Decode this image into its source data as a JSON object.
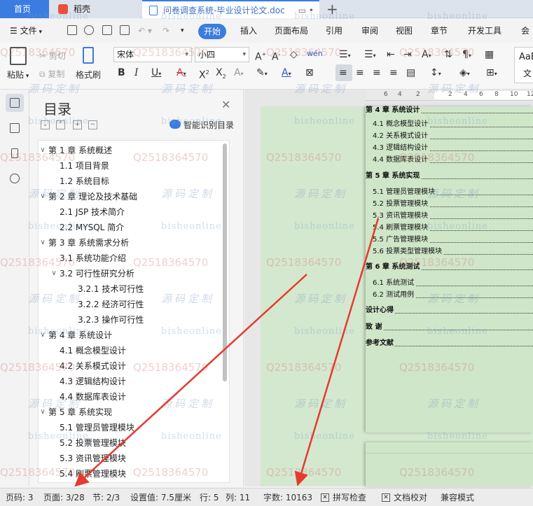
{
  "titlebar": {
    "home_tab": "首页",
    "daoke_tab": "稻壳",
    "doc_tab": "问卷调查系统-毕业设计论文.doc",
    "add_tab": "+"
  },
  "menu": {
    "file": "文件",
    "items": [
      "开始",
      "插入",
      "页面布局",
      "引用",
      "审阅",
      "视图",
      "章节",
      "开发工具",
      "会员"
    ]
  },
  "ribbon": {
    "cut": "剪切",
    "paste": "粘贴",
    "copy": "复制",
    "format_painter": "格式刷",
    "font_name": "宋体",
    "font_size": "小四",
    "style_sample": "AaBl",
    "style_label": "文"
  },
  "toc": {
    "title": "目录",
    "smart_button": "智能识别目录",
    "items": [
      {
        "label": "第 1 章  系统概述",
        "level": 0,
        "expanded": true
      },
      {
        "label": "1.1  项目背景",
        "level": 1
      },
      {
        "label": "1.2  系统目标",
        "level": 1
      },
      {
        "label": "第 2 章  理论及技术基础",
        "level": 0,
        "expanded": true
      },
      {
        "label": "2.1  JSP 技术简介",
        "level": 1
      },
      {
        "label": "2.2  MYSQL 简介",
        "level": 1
      },
      {
        "label": "第 3 章  系统需求分析",
        "level": 0,
        "expanded": true
      },
      {
        "label": "3.1  系统功能介绍",
        "level": 1
      },
      {
        "label": "3.2  可行性研究分析",
        "level": 1,
        "expanded": true
      },
      {
        "label": "3.2.1  技术可行性",
        "level": 2
      },
      {
        "label": "3.2.2  经济可行性",
        "level": 2
      },
      {
        "label": "3.2.3  操作可行性",
        "level": 2
      },
      {
        "label": "第 4 章  系统设计",
        "level": 0,
        "expanded": true
      },
      {
        "label": "4.1  概念模型设计",
        "level": 1
      },
      {
        "label": "4.2  关系模式设计",
        "level": 1
      },
      {
        "label": "4.3  逻辑结构设计",
        "level": 1
      },
      {
        "label": "4.4  数据库表设计",
        "level": 1
      },
      {
        "label": "第 5 章  系统实现",
        "level": 0,
        "expanded": true
      },
      {
        "label": "5.1  管理员管理模块",
        "level": 1
      },
      {
        "label": "5.2  投票管理模块",
        "level": 1
      },
      {
        "label": "5.3  资讯管理模块",
        "level": 1
      },
      {
        "label": "5.4  刷票管理模块",
        "level": 1
      }
    ]
  },
  "ruler": {
    "numbers": [
      "6",
      "4",
      "2",
      "2",
      "4",
      "6",
      "8",
      "10",
      "12"
    ]
  },
  "document": {
    "lines": [
      {
        "text": "第 4 章  系统设计",
        "bold": true,
        "indent": 0
      },
      {
        "text": "4.1 概念模型设计",
        "bold": false,
        "indent": 1
      },
      {
        "text": "4.2 关系模式设计",
        "bold": false,
        "indent": 1
      },
      {
        "text": "4.3 逻辑结构设计",
        "bold": false,
        "indent": 1
      },
      {
        "text": "4.4 数据库表设计",
        "bold": false,
        "indent": 1
      },
      {
        "text": "第 5 章  系统实现",
        "bold": true,
        "indent": 0
      },
      {
        "text": "5.1 管理员管理模块",
        "bold": false,
        "indent": 1
      },
      {
        "text": "5.2 投票管理模块",
        "bold": false,
        "indent": 1
      },
      {
        "text": "5.3 资讯管理模块",
        "bold": false,
        "indent": 1
      },
      {
        "text": "5.4 刷票管理模块",
        "bold": false,
        "indent": 1
      },
      {
        "text": "5.5 广告管理模块",
        "bold": false,
        "indent": 1
      },
      {
        "text": "5.6 投票类型管理模块",
        "bold": false,
        "indent": 1
      },
      {
        "text": "第 6 章  系统测试",
        "bold": true,
        "indent": 0
      },
      {
        "text": "6.1 系统测试",
        "bold": false,
        "indent": 1
      },
      {
        "text": "6.2 测试用例",
        "bold": false,
        "indent": 1
      },
      {
        "text": "设计心得",
        "bold": true,
        "indent": 0
      },
      {
        "text": "致    谢",
        "bold": true,
        "indent": 0
      },
      {
        "text": "参考文献",
        "bold": true,
        "indent": 0
      }
    ]
  },
  "watermark": {
    "site": "bisheonline",
    "qq": "Q2518364570",
    "cn": "源码定制"
  },
  "status": {
    "page_no": "页码: 3",
    "page": "页面: 3/28",
    "section": "节: 2/3",
    "setting": "设置值: 7.5厘米",
    "row": "行: 5",
    "col": "列: 11",
    "words": "字数: 10163",
    "spell": "拼写检查",
    "proof": "文档校对",
    "compat": "兼容模式"
  },
  "colors": {
    "accent": "#3b7ce0",
    "page": "#cfe6c8",
    "arrow": "#e53a2f"
  }
}
